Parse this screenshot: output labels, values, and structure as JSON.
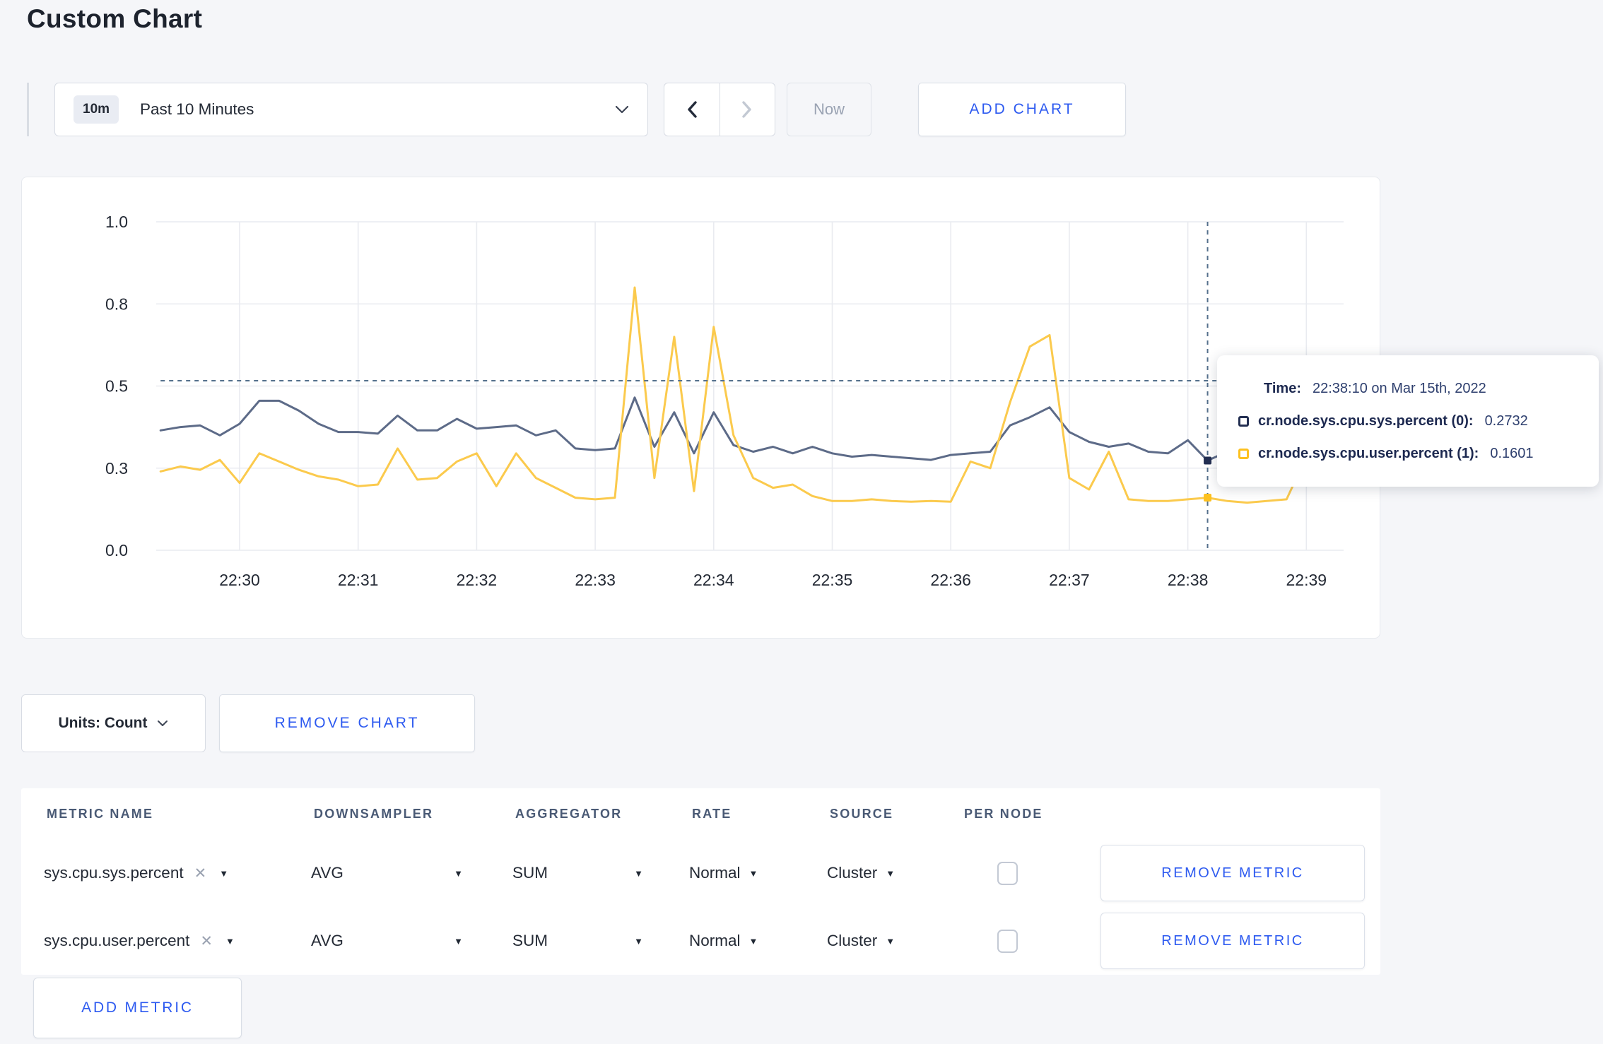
{
  "page": {
    "title": "Custom Chart"
  },
  "colors": {
    "accent_blue": "#2d5af0",
    "page_background": "#f5f6f9",
    "series_sys_line": "#5d6b88",
    "series_user_line": "#fbca4d",
    "gridline": "#e9ebf0",
    "crosshair": "#54708c"
  },
  "icons": {
    "caret_down": "▼",
    "remove_tag": "✕"
  },
  "controls": {
    "time_window_badge": "10m",
    "time_window_label": "Past 10 Minutes",
    "now_label": "Now",
    "add_chart_label": "ADD CHART"
  },
  "chart": {
    "units_label": "Units: Count",
    "remove_chart_label": "REMOVE CHART",
    "hover": {
      "time": "22:38:10",
      "guide_value": 0.516,
      "series_values": [
        0.2732,
        0.1601
      ]
    },
    "tooltip": {
      "time_label": "Time:",
      "time_value": "22:38:10 on Mar 15th, 2022",
      "series": [
        {
          "name": "cr.node.sys.cpu.sys.percent (0):",
          "value": "0.2732",
          "swatch_color": "#232f52"
        },
        {
          "name": "cr.node.sys.cpu.user.percent (1):",
          "value": "0.1601",
          "swatch_color": "#fdc11f"
        }
      ]
    }
  },
  "chart_data": {
    "type": "line",
    "title": "",
    "xlabel": "",
    "ylabel": "",
    "ylim": [
      0,
      1
    ],
    "grid": true,
    "legend_position": "tooltip-only",
    "y_ticks": [
      {
        "v": 0.0,
        "label": "0.0"
      },
      {
        "v": 0.25,
        "label": "0.3"
      },
      {
        "v": 0.5,
        "label": "0.5"
      },
      {
        "v": 0.75,
        "label": "0.8"
      },
      {
        "v": 1.0,
        "label": "1.0"
      }
    ],
    "x_ticks": [
      "22:30",
      "22:31",
      "22:32",
      "22:33",
      "22:34",
      "22:35",
      "22:36",
      "22:37",
      "22:38",
      "22:39"
    ],
    "x": [
      "22:29:20",
      "22:29:30",
      "22:29:40",
      "22:29:50",
      "22:30:00",
      "22:30:10",
      "22:30:20",
      "22:30:30",
      "22:30:40",
      "22:30:50",
      "22:31:00",
      "22:31:10",
      "22:31:20",
      "22:31:30",
      "22:31:40",
      "22:31:50",
      "22:32:00",
      "22:32:10",
      "22:32:20",
      "22:32:30",
      "22:32:40",
      "22:32:50",
      "22:33:00",
      "22:33:10",
      "22:33:20",
      "22:33:30",
      "22:33:40",
      "22:33:50",
      "22:34:00",
      "22:34:10",
      "22:34:20",
      "22:34:30",
      "22:34:40",
      "22:34:50",
      "22:35:00",
      "22:35:10",
      "22:35:20",
      "22:35:30",
      "22:35:40",
      "22:35:50",
      "22:36:00",
      "22:36:10",
      "22:36:20",
      "22:36:30",
      "22:36:40",
      "22:36:50",
      "22:37:00",
      "22:37:10",
      "22:37:20",
      "22:37:30",
      "22:37:40",
      "22:37:50",
      "22:38:00",
      "22:38:10",
      "22:38:20",
      "22:38:30",
      "22:38:40",
      "22:38:50",
      "22:39:00",
      "22:39:10",
      "22:39:20"
    ],
    "series": [
      {
        "name": "cr.node.sys.cpu.sys.percent (0)",
        "color": "#5d6b88",
        "values": [
          0.365,
          0.375,
          0.38,
          0.35,
          0.385,
          0.455,
          0.455,
          0.425,
          0.385,
          0.36,
          0.36,
          0.355,
          0.41,
          0.365,
          0.365,
          0.4,
          0.37,
          0.375,
          0.38,
          0.35,
          0.365,
          0.31,
          0.305,
          0.31,
          0.465,
          0.315,
          0.42,
          0.295,
          0.42,
          0.32,
          0.3,
          0.315,
          0.295,
          0.315,
          0.295,
          0.285,
          0.29,
          0.285,
          0.28,
          0.275,
          0.29,
          0.295,
          0.3,
          0.38,
          0.405,
          0.435,
          0.36,
          0.33,
          0.315,
          0.325,
          0.3,
          0.295,
          0.335,
          0.2732,
          0.3,
          0.295,
          0.3,
          0.305,
          0.3,
          0.305,
          0.3
        ]
      },
      {
        "name": "cr.node.sys.cpu.user.percent (1)",
        "color": "#fbca4d",
        "values": [
          0.24,
          0.255,
          0.245,
          0.275,
          0.205,
          0.295,
          0.27,
          0.245,
          0.225,
          0.215,
          0.195,
          0.2,
          0.31,
          0.215,
          0.22,
          0.27,
          0.295,
          0.195,
          0.295,
          0.22,
          0.19,
          0.16,
          0.155,
          0.16,
          0.8,
          0.22,
          0.65,
          0.18,
          0.68,
          0.35,
          0.22,
          0.19,
          0.2,
          0.165,
          0.15,
          0.15,
          0.155,
          0.15,
          0.148,
          0.15,
          0.148,
          0.27,
          0.25,
          0.45,
          0.62,
          0.655,
          0.22,
          0.185,
          0.3,
          0.155,
          0.15,
          0.15,
          0.155,
          0.1601,
          0.15,
          0.145,
          0.15,
          0.155,
          0.285,
          0.27,
          0.235
        ]
      }
    ]
  },
  "metrics_table": {
    "headers": [
      "METRIC NAME",
      "DOWNSAMPLER",
      "AGGREGATOR",
      "RATE",
      "SOURCE",
      "PER NODE"
    ],
    "rows": [
      {
        "metric": "sys.cpu.sys.percent",
        "downsampler": "AVG",
        "aggregator": "SUM",
        "rate": "Normal",
        "source": "Cluster",
        "per_node_checked": false,
        "remove_label": "REMOVE METRIC"
      },
      {
        "metric": "sys.cpu.user.percent",
        "downsampler": "AVG",
        "aggregator": "SUM",
        "rate": "Normal",
        "source": "Cluster",
        "per_node_checked": false,
        "remove_label": "REMOVE METRIC"
      }
    ],
    "add_metric_label": "ADD METRIC"
  }
}
